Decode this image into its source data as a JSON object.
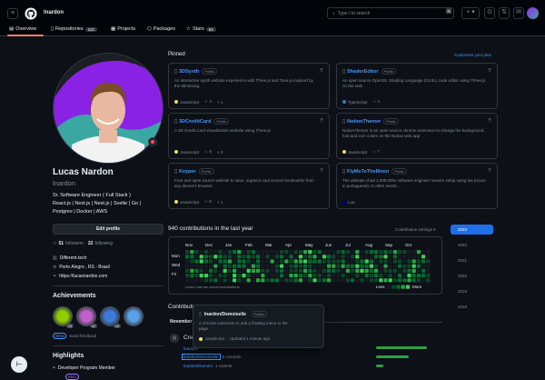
{
  "header": {
    "username": "lnardon",
    "search_placeholder": "Type / to search",
    "key_hint": "/"
  },
  "tabs": [
    {
      "label": "Overview",
      "count": ""
    },
    {
      "label": "Repositories",
      "count": "110"
    },
    {
      "label": "Projects",
      "count": ""
    },
    {
      "label": "Packages",
      "count": ""
    },
    {
      "label": "Stars",
      "count": "84"
    }
  ],
  "profile": {
    "name": "Lucas Nardon",
    "login": "lnardon",
    "bio_line1": "Sr. Software Engineer ( Full Stack )",
    "bio_line2": "React.js | Next.js | Nest.js | Svelte | Go |",
    "bio_line3": "Postgres | Docker | AWS",
    "edit_label": "Edit profile",
    "followers": "51",
    "followers_label": "followers ·",
    "following": "22",
    "following_label": "following",
    "company": "Different.tech",
    "location": "Porto Alegre , RS - Brasil",
    "url": "https://lucasnardon.com"
  },
  "achievements": {
    "title": "Achievements",
    "badges": [
      {
        "name": "pull-shark",
        "count": "x3",
        "color": "#8fce00"
      },
      {
        "name": "starstruck",
        "count": "x2",
        "color": "#c061cb"
      },
      {
        "name": "pair-extraordinaire",
        "count": "x3",
        "color": "#3c7bd9"
      },
      {
        "name": "quickdraw",
        "count": "",
        "color": "#5aa0e6"
      }
    ],
    "beta": "Beta",
    "feedback": "Send feedback"
  },
  "highlights": {
    "title": "Highlights",
    "item": "Developer Program Member",
    "pro": "PRO"
  },
  "pinned": {
    "title": "Pinned",
    "customize": "Customize your pins",
    "cards": [
      {
        "name": "3DSynth",
        "badge": "Public",
        "desc": "An interactive synth website experience with Three.js and Tone.js inspired by the Minimoog.",
        "lang": "JavaScript",
        "lang_color": "#f1e05a",
        "stars": "3",
        "forks": "1"
      },
      {
        "name": "ShaderEditor",
        "badge": "Public",
        "desc": "An open source OpenGL Shading Language (GLSL) code editor using Three.js on the web",
        "lang": "TypeScript",
        "lang_color": "#3178c6",
        "stars": "1",
        "forks": ""
      },
      {
        "name": "3DCreditCard",
        "badge": "Public",
        "desc": "A 3D Credit Card visualization website using Three.js",
        "lang": "JavaScript",
        "lang_color": "#f1e05a",
        "stars": "5",
        "forks": "3"
      },
      {
        "name": "NotionThemer",
        "badge": "Public",
        "desc": "NotionThemer is an open source chrome extension to change the background, font and icon colors on the Notion web app",
        "lang": "JavaScript",
        "lang_color": "#f1e05a",
        "stars": "7",
        "forks": ""
      },
      {
        "name": "Keyper",
        "badge": "Public",
        "desc": "Free and open source website to save, organize and access bookmarks from any device's browser.",
        "lang": "JavaScript",
        "lang_color": "#f1e05a",
        "stars": "6",
        "forks": "1"
      },
      {
        "name": "FlyMeToTheMoon",
        "badge": "Public",
        "desc": "The ultimate chad 1.000.000x software engineer neovim setup using lua (moon in portuguese). In other words ...",
        "lang": "Lua",
        "lang_color": "#000080",
        "stars": "",
        "forks": ""
      }
    ]
  },
  "contrib": {
    "title": "940 contributions in the last year",
    "settings": "Contribution settings",
    "months": [
      "Nov",
      "Dec",
      "Jan",
      "Feb",
      "Mar",
      "Apr",
      "May",
      "Jun",
      "Jul",
      "Aug",
      "Sep",
      "Oct"
    ],
    "days": [
      "Mon",
      "Wed",
      "Fri"
    ],
    "learn": "Learn how we count contributions",
    "less": "Less",
    "more": "More",
    "years": [
      "2023",
      "2022",
      "2021",
      "2020",
      "2019",
      "2018"
    ]
  },
  "activity": {
    "title": "Contributi",
    "month": "November",
    "created": "Cre",
    "repos": [
      {
        "name": "lnardon/",
        "commits": ""
      },
      {
        "name": "lnardon/Demoiselle",
        "commits": "6 commits"
      },
      {
        "name": "lnardon/Dumont",
        "commits": "1 commit"
      }
    ]
  },
  "popup": {
    "name": "lnardon/Demoiselle",
    "badge": "Public",
    "desc": "A chrome extension to add a floating menu to the page.",
    "lang": "JavaScript",
    "updated": "Updated 1 minute ago"
  }
}
